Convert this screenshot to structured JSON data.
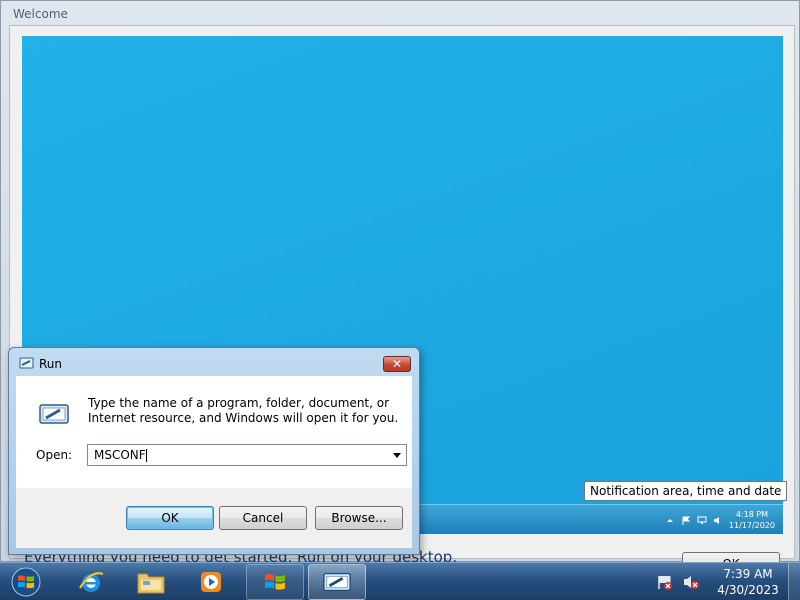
{
  "welcome": {
    "title": "Welcome",
    "footer_text": "Everything you need to get started. Run on your desktop.",
    "ok_label": "OK",
    "tooltip": "Notification area, time and date",
    "preview_clock": {
      "time": "4:18 PM",
      "date": "11/17/2020"
    }
  },
  "run_dialog": {
    "title": "Run",
    "close_label": "✕",
    "description": "Type the name of a program, folder, document, or Internet resource, and Windows will open it for you.",
    "open_label": "Open:",
    "input_value": "MSCONF",
    "buttons": {
      "ok": "OK",
      "cancel": "Cancel",
      "browse": "Browse..."
    }
  },
  "taskbar": {
    "items": [
      "start-button",
      "internet-explorer",
      "windows-explorer",
      "media-player",
      "welcome-center",
      "run"
    ],
    "clock": {
      "time": "7:39 AM",
      "date": "4/30/2023"
    }
  },
  "colors": {
    "desktop_blue": "#1ea9e2",
    "taskbar": "#27507f",
    "close_red": "#c74a34"
  }
}
